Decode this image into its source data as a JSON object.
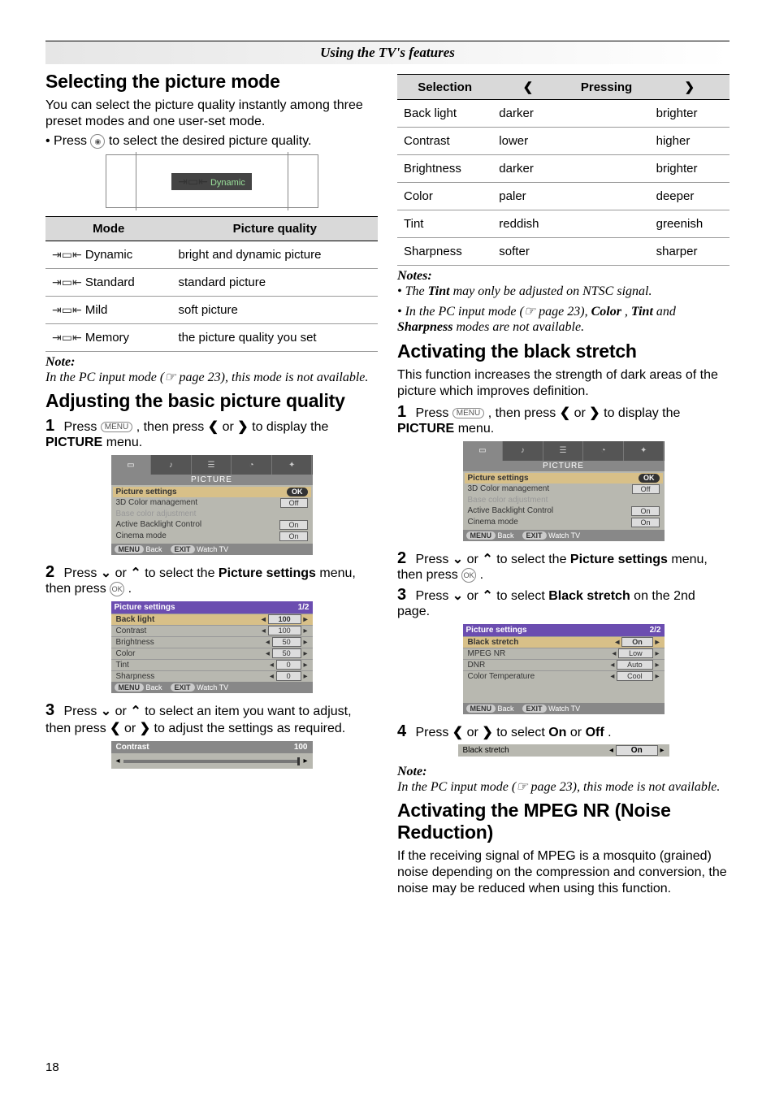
{
  "page_number": "18",
  "section_header": "Using the TV's features",
  "left": {
    "h_select": "Selecting the picture mode",
    "p_select_1": "You can select the picture quality instantly among three preset modes and one user-set mode.",
    "p_select_2": "• Press ",
    "p_select_3": " to select the desired picture quality.",
    "osd_dynamic": "Dynamic",
    "mode_table": {
      "head_mode": "Mode",
      "head_quality": "Picture quality",
      "rows": [
        {
          "mode": "Dynamic",
          "quality": "bright and dynamic picture"
        },
        {
          "mode": "Standard",
          "quality": "standard picture"
        },
        {
          "mode": "Mild",
          "quality": "soft picture"
        },
        {
          "mode": "Memory",
          "quality": "the picture quality you set"
        }
      ]
    },
    "note_label": "Note:",
    "note_text": "In the PC input mode (☞ page 23), this mode is not available.",
    "h_adjust": "Adjusting the basic picture quality",
    "step1_a": "Press ",
    "step1_b": ", then press ",
    "step1_c": " or ",
    "step1_d": " to display the ",
    "step1_e": "PICTURE",
    "step1_f": " menu.",
    "picture_menu": {
      "title": "PICTURE",
      "rows": [
        {
          "label": "Picture settings",
          "val": "OK",
          "sel": true,
          "ok": true
        },
        {
          "label": "3D Color management",
          "val": "Off"
        },
        {
          "label": "Base color adjustment",
          "dis": true
        },
        {
          "label": "Active Backlight Control",
          "val": "On"
        },
        {
          "label": "Cinema mode",
          "val": "On"
        }
      ],
      "footer_back": "Back",
      "footer_watch": "Watch TV",
      "btn_menu": "MENU",
      "btn_exit": "EXIT"
    },
    "step2_a": "Press ",
    "step2_b": " or ",
    "step2_c": " to select the ",
    "step2_d": "Picture settings",
    "step2_e": " menu, then press ",
    "step2_f": ".",
    "picture_settings": {
      "title": "Picture settings",
      "page": "1/2",
      "rows": [
        {
          "label": "Back light",
          "val": "100",
          "sel": true
        },
        {
          "label": "Contrast",
          "val": "100"
        },
        {
          "label": "Brightness",
          "val": "50"
        },
        {
          "label": "Color",
          "val": "50"
        },
        {
          "label": "Tint",
          "val": "0"
        },
        {
          "label": "Sharpness",
          "val": "0"
        }
      ],
      "footer_back": "Back",
      "footer_watch": "Watch TV",
      "btn_menu": "MENU",
      "btn_exit": "EXIT"
    },
    "step3_a": "Press ",
    "step3_b": " or ",
    "step3_c": " to select an item you want to adjust, then press ",
    "step3_d": " or ",
    "step3_e": " to adjust the settings as required.",
    "slider": {
      "label": "Contrast",
      "val": "100"
    }
  },
  "right": {
    "sel_table": {
      "head_selection": "Selection",
      "head_left": "❮",
      "head_pressing": "Pressing",
      "head_right": "❯",
      "rows": [
        {
          "s": "Back light",
          "l": "darker",
          "r": "brighter"
        },
        {
          "s": "Contrast",
          "l": "lower",
          "r": "higher"
        },
        {
          "s": "Brightness",
          "l": "darker",
          "r": "brighter"
        },
        {
          "s": "Color",
          "l": "paler",
          "r": "deeper"
        },
        {
          "s": "Tint",
          "l": "reddish",
          "r": "greenish"
        },
        {
          "s": "Sharpness",
          "l": "softer",
          "r": "sharper"
        }
      ]
    },
    "notes_label": "Notes:",
    "notes_1a": "• The ",
    "notes_1b": "Tint",
    "notes_1c": " may only be adjusted on NTSC signal.",
    "notes_2a": "• In the PC input mode (☞ page 23), ",
    "notes_2b": "Color",
    "notes_2c": ", ",
    "notes_2d": "Tint",
    "notes_2e": " and ",
    "notes_2f": "Sharpness",
    "notes_2g": " modes are not available.",
    "h_black": "Activating the black stretch",
    "p_black": "This function increases the strength of dark areas of the picture which improves definition.",
    "bstep1_a": "Press ",
    "bstep1_b": ", then press ",
    "bstep1_c": " or ",
    "bstep1_d": " to display the ",
    "bstep1_e": "PICTURE",
    "bstep1_f": " menu.",
    "bstep2_a": "Press ",
    "bstep2_b": " or ",
    "bstep2_c": " to select the ",
    "bstep2_d": "Picture settings",
    "bstep2_e": " menu, then press ",
    "bstep2_f": ".",
    "bstep3_a": "Press ",
    "bstep3_b": " or ",
    "bstep3_c": " to select ",
    "bstep3_d": "Black stretch",
    "bstep3_e": " on the 2nd page.",
    "black_settings": {
      "title": "Picture settings",
      "page": "2/2",
      "rows": [
        {
          "label": "Black stretch",
          "val": "On",
          "sel": true
        },
        {
          "label": "MPEG NR",
          "val": "Low"
        },
        {
          "label": "DNR",
          "val": "Auto"
        },
        {
          "label": "Color Temperature",
          "val": "Cool"
        }
      ],
      "footer_back": "Back",
      "footer_watch": "Watch TV",
      "btn_menu": "MENU",
      "btn_exit": "EXIT"
    },
    "bstep4_a": "Press ",
    "bstep4_b": " or ",
    "bstep4_c": " to select ",
    "bstep4_d": "On",
    "bstep4_e": " or ",
    "bstep4_f": "Off",
    "bstep4_g": ".",
    "inline_black": {
      "label": "Black stretch",
      "val": "On"
    },
    "bnote_label": "Note:",
    "bnote_text": "In the PC input mode (☞ page 23), this mode is not available.",
    "h_mpeg": "Activating the MPEG NR (Noise Reduction)",
    "p_mpeg": "If the receiving signal of MPEG is a mosquito (grained) noise depending on the compression and conversion, the noise may be reduced when using this function."
  }
}
